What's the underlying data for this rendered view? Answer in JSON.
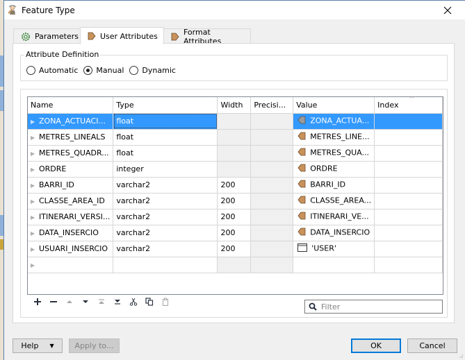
{
  "window": {
    "title": "Feature Type",
    "close_label": "Close"
  },
  "tabs": [
    {
      "label": "Parameters",
      "icon": "gear-icon",
      "active": false
    },
    {
      "label": "User Attributes",
      "icon": "attribute-arrow-icon",
      "active": true
    },
    {
      "label": "Format Attributes",
      "icon": "attribute-arrow-icon",
      "active": false
    }
  ],
  "attribute_definition": {
    "label": "Attribute Definition",
    "options": [
      {
        "label": "Automatic",
        "selected": false
      },
      {
        "label": "Manual",
        "selected": true
      },
      {
        "label": "Dynamic",
        "selected": false
      }
    ]
  },
  "table": {
    "columns": [
      "Name",
      "Type",
      "Width",
      "Precisi...",
      "Value",
      "Index"
    ],
    "sorted_column": "Index",
    "rows": [
      {
        "name": "ZONA_ACTUACI...",
        "type": "float",
        "width": "",
        "precision": "",
        "value": "ZONA_ACTUA...",
        "value_icon": "attribute-value-icon",
        "index": "",
        "selected": true
      },
      {
        "name": "METRES_LINEALS",
        "type": "float",
        "width": "",
        "precision": "",
        "value": "METRES_LINE...",
        "value_icon": "attribute-value-icon",
        "index": ""
      },
      {
        "name": "METRES_QUADR...",
        "type": "float",
        "width": "",
        "precision": "",
        "value": "METRES_QUA...",
        "value_icon": "attribute-value-icon",
        "index": ""
      },
      {
        "name": "ORDRE",
        "type": "integer",
        "width": "",
        "precision": "",
        "value": "ORDRE",
        "value_icon": "attribute-value-icon",
        "index": ""
      },
      {
        "name": "BARRI_ID",
        "type": "varchar2",
        "width": "200",
        "precision": "",
        "value": "BARRI_ID",
        "value_icon": "attribute-value-icon",
        "index": ""
      },
      {
        "name": "CLASSE_AREA_ID",
        "type": "varchar2",
        "width": "200",
        "precision": "",
        "value": "CLASSE_AREA...",
        "value_icon": "attribute-value-icon",
        "index": ""
      },
      {
        "name": "ITINERARI_VERSI...",
        "type": "varchar2",
        "width": "200",
        "precision": "",
        "value": "ITINERARI_VE...",
        "value_icon": "attribute-value-icon",
        "index": ""
      },
      {
        "name": "DATA_INSERCIO",
        "type": "varchar2",
        "width": "200",
        "precision": "",
        "value": "DATA_INSERCIO",
        "value_icon": "attribute-value-icon",
        "index": ""
      },
      {
        "name": "USUARI_INSERCIO",
        "type": "varchar2",
        "width": "200",
        "precision": "",
        "value": "'USER'",
        "value_icon": "constant-value-icon",
        "index": ""
      },
      {
        "name": "",
        "type": "",
        "width": "",
        "precision": "",
        "value": "",
        "value_icon": "",
        "index": "",
        "empty": true
      }
    ]
  },
  "toolbar": {
    "buttons": [
      {
        "name": "add-row-button",
        "icon": "plus-icon",
        "enabled": true
      },
      {
        "name": "remove-row-button",
        "icon": "minus-icon",
        "enabled": true
      },
      {
        "name": "move-up-button",
        "icon": "arrow-up-icon",
        "enabled": false
      },
      {
        "name": "move-down-button",
        "icon": "arrow-down-icon",
        "enabled": true
      },
      {
        "name": "move-top-button",
        "icon": "arrow-top-icon",
        "enabled": false
      },
      {
        "name": "move-bottom-button",
        "icon": "arrow-bottom-icon",
        "enabled": true
      },
      {
        "name": "cut-button",
        "icon": "scissors-icon",
        "enabled": true
      },
      {
        "name": "copy-button",
        "icon": "copy-icon",
        "enabled": true
      },
      {
        "name": "paste-button",
        "icon": "clipboard-icon",
        "enabled": false
      }
    ]
  },
  "filter": {
    "placeholder": "Filter",
    "value": ""
  },
  "footer": {
    "help_label": "Help",
    "apply_label": "Apply to...",
    "ok_label": "OK",
    "cancel_label": "Cancel"
  },
  "colors": {
    "selection": "#3399ff",
    "attribute_icon": "#c8925a",
    "default_button_border": "#0078d7"
  }
}
